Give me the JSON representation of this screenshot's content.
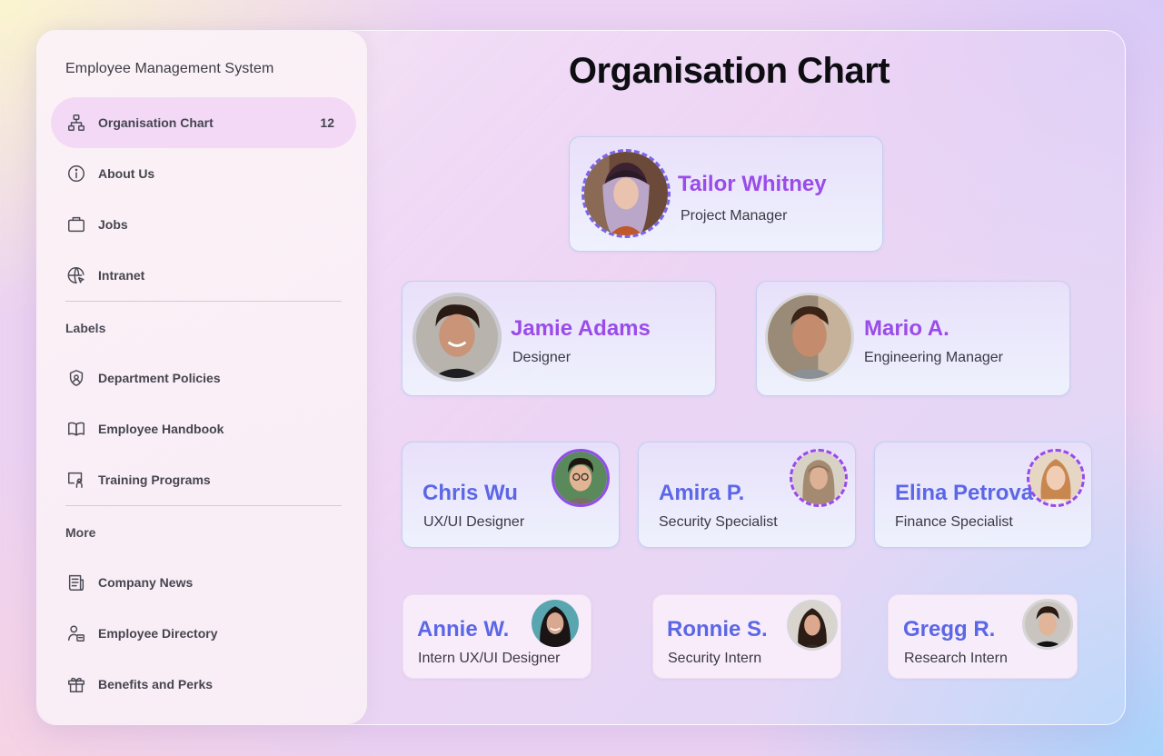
{
  "sidebar": {
    "app_title": "Employee Management System",
    "primary": [
      {
        "label": "Organisation Chart",
        "count": "12",
        "icon": "org-chart-icon"
      },
      {
        "label": "About Us",
        "icon": "info-icon"
      },
      {
        "label": "Jobs",
        "icon": "briefcase-icon"
      },
      {
        "label": "Intranet",
        "icon": "globe-cursor-icon"
      }
    ],
    "labels_heading": "Labels",
    "labels": [
      {
        "label": "Department Policies",
        "icon": "shield-user-icon"
      },
      {
        "label": "Employee Handbook",
        "icon": "book-icon"
      },
      {
        "label": "Training Programs",
        "icon": "presentation-icon"
      }
    ],
    "more_heading": "More",
    "more": [
      {
        "label": "Company News",
        "icon": "newspaper-icon"
      },
      {
        "label": "Employee Directory",
        "icon": "id-card-icon"
      },
      {
        "label": "Benefits and Perks",
        "icon": "gift-icon"
      }
    ]
  },
  "main": {
    "title": "Organisation Chart",
    "employees": [
      {
        "name": "Tailor Whitney",
        "role": "Project Manager"
      },
      {
        "name": "Jamie Adams",
        "role": "Designer"
      },
      {
        "name": "Mario A.",
        "role": "Engineering Manager"
      },
      {
        "name": "Chris Wu",
        "role": "UX/UI Designer"
      },
      {
        "name": "Amira P.",
        "role": "Security Specialist"
      },
      {
        "name": "Elina Petrova",
        "role": "Finance Specialist"
      },
      {
        "name": "Annie W.",
        "role": "Intern UX/UI Designer"
      },
      {
        "name": "Ronnie S.",
        "role": "Security Intern"
      },
      {
        "name": "Gregg R.",
        "role": "Research Intern"
      }
    ]
  },
  "colors": {
    "accent_purple": "#9a4be9",
    "accent_blue": "#5b67e6",
    "active_nav_bg": "#f3d9f6"
  }
}
